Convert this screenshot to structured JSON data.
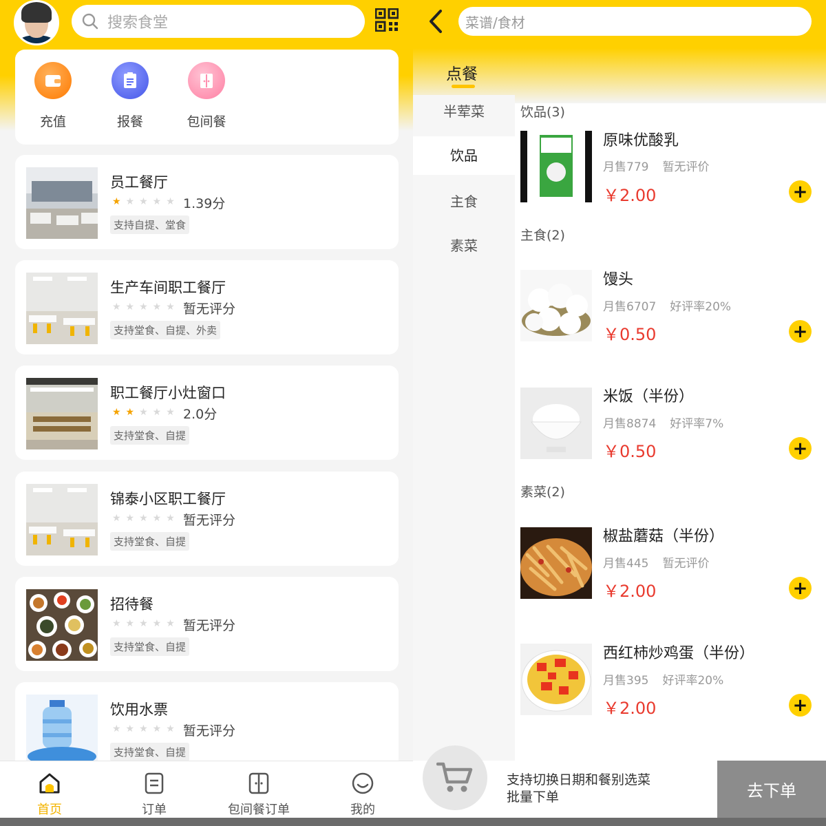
{
  "left": {
    "search_placeholder": "搜索食堂",
    "quick_actions": [
      {
        "label": "充值",
        "icon": "wallet-icon",
        "color": "#ff8a1e"
      },
      {
        "label": "报餐",
        "icon": "clipboard-icon",
        "color": "#5b6ef5"
      },
      {
        "label": "包间餐",
        "icon": "door-icon",
        "color": "#ff8fb0"
      }
    ],
    "shops": [
      {
        "name": "员工餐厅",
        "stars_filled": 1,
        "rating": "1.39分",
        "tags": "支持自提、堂食"
      },
      {
        "name": "生产车间职工餐厅",
        "stars_filled": 0,
        "rating": "暂无评分",
        "tags": "支持堂食、自提、外卖"
      },
      {
        "name": "职工餐厅小灶窗口",
        "stars_filled": 2,
        "rating": "2.0分",
        "tags": "支持堂食、自提"
      },
      {
        "name": "锦泰小区职工餐厅",
        "stars_filled": 0,
        "rating": "暂无评分",
        "tags": "支持堂食、自提"
      },
      {
        "name": "招待餐",
        "stars_filled": 0,
        "rating": "暂无评分",
        "tags": "支持堂食、自提"
      },
      {
        "name": "饮用水票",
        "stars_filled": 0,
        "rating": "暂无评分",
        "tags": "支持堂食、自提"
      }
    ],
    "tabs": [
      {
        "label": "首页",
        "icon": "home-icon",
        "active": true
      },
      {
        "label": "订单",
        "icon": "order-icon",
        "active": false
      },
      {
        "label": "包间餐订单",
        "icon": "room-order-icon",
        "active": false
      },
      {
        "label": "我的",
        "icon": "profile-icon",
        "active": false
      }
    ],
    "accent": "#ffd000"
  },
  "right": {
    "search_placeholder": "菜谱/食材",
    "title": "点餐",
    "categories": [
      "半荤菜",
      "饮品",
      "主食",
      "素菜"
    ],
    "active_category": "饮品",
    "sections": [
      {
        "header": "饮品(3)",
        "items": [
          {
            "name": "原味优酸乳",
            "sales": "月售779",
            "review": "暂无评价",
            "price": "￥2.00"
          }
        ]
      },
      {
        "header": "主食(2)",
        "items": [
          {
            "name": "馒头",
            "sales": "月售6707",
            "review": "好评率20%",
            "price": "￥0.50"
          },
          {
            "name": "米饭（半份）",
            "sales": "月售8874",
            "review": "好评率7%",
            "price": "￥0.50"
          }
        ]
      },
      {
        "header": "素菜(2)",
        "items": [
          {
            "name": "椒盐蘑菇（半份）",
            "sales": "月售445",
            "review": "暂无评价",
            "price": "￥2.00"
          },
          {
            "name": "西红柿炒鸡蛋（半份）",
            "sales": "月售395",
            "review": "好评率20%",
            "price": "￥2.00"
          }
        ]
      }
    ],
    "cart_text_line1": "支持切换日期和餐别选菜",
    "cart_text_line2": "批量下单",
    "checkout_label": "去下单",
    "price_color": "#e93a2e"
  }
}
